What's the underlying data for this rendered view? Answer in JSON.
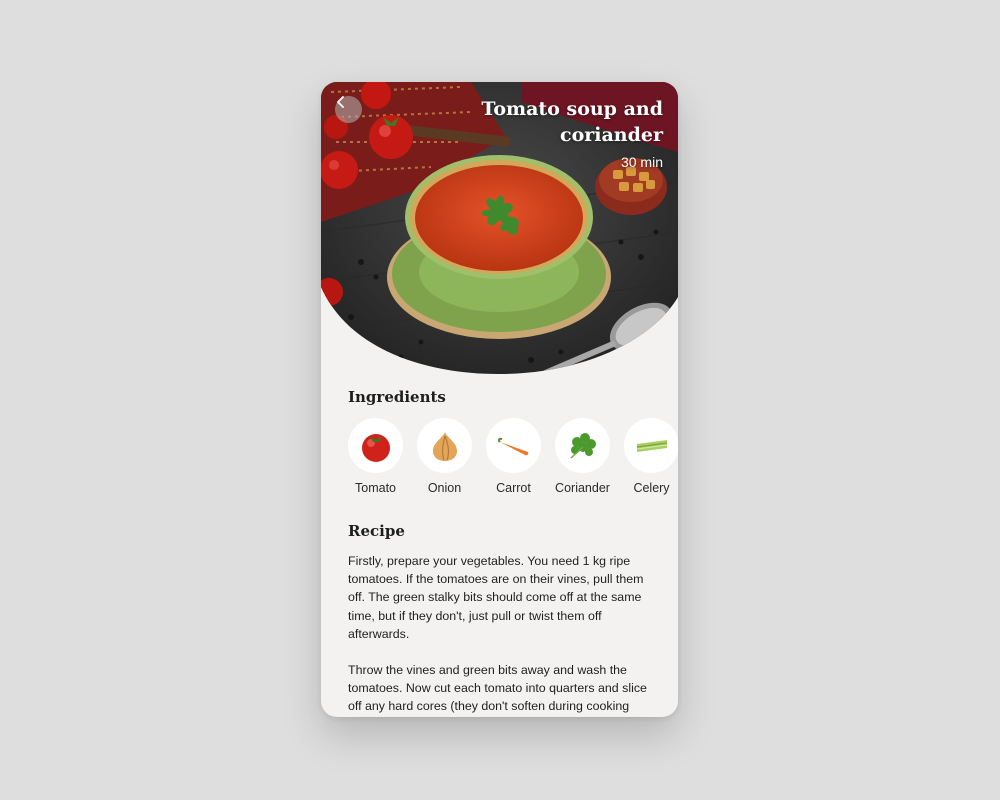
{
  "recipe": {
    "title": "Tomato soup and coriander",
    "time": "30 min"
  },
  "navigation": {
    "back_icon": "chevron-left-icon"
  },
  "ingredients_section": {
    "heading": "Ingredients",
    "items": [
      {
        "label": "Tomato",
        "icon": "tomato-icon"
      },
      {
        "label": "Onion",
        "icon": "onion-icon"
      },
      {
        "label": "Carrot",
        "icon": "carrot-icon"
      },
      {
        "label": "Coriander",
        "icon": "coriander-icon"
      },
      {
        "label": "Celery",
        "icon": "celery-icon"
      }
    ]
  },
  "recipe_section": {
    "heading": "Recipe",
    "paragraphs": [
      "Firstly, prepare your vegetables. You need 1 kg ripe tomatoes. If the tomatoes are on their vines, pull them off. The green stalky bits should come off at the same time, but if they don't, just pull or twist them off afterwards.",
      "Throw the vines and green bits away and wash the tomatoes. Now cut each tomato into quarters and slice off any hard cores (they don't soften during cooking and"
    ]
  },
  "colors": {
    "background": "#dedede",
    "card": "#f3f2f0",
    "soup": "#d8431c",
    "bowl": "#8fae5a"
  }
}
